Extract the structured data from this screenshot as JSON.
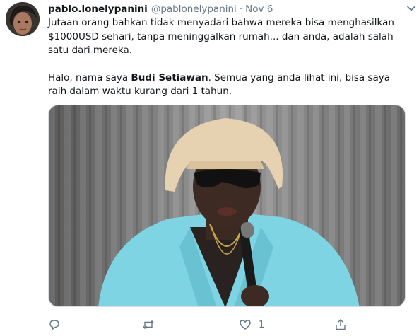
{
  "tweet": {
    "display_name": "pablo.lonelypanini",
    "handle": "@pablonelypanini",
    "separator": "·",
    "date": "Nov 6",
    "paragraph1": "Jutaan orang bahkan tidak menyadari bahwa mereka bisa menghasilkan $1000USD sehari, tanpa meninggalkan rumah... dan anda, adalah salah satu dari mereka.",
    "paragraph2_pre": "Halo, nama saya ",
    "paragraph2_bold": "Budi Setiawan",
    "paragraph2_post": ". Semua yang anda lihat ini, bisa saya raih dalam waktu kurang dari 1 tahun.",
    "like_count": "1"
  },
  "icons": {
    "reply": "reply-icon",
    "retweet": "retweet-icon",
    "like": "heart-icon",
    "share": "share-icon",
    "more": "chevron-down-icon"
  },
  "colors": {
    "text": "#14171a",
    "muted": "#657786",
    "jacket": "#7fd4e3",
    "wig": "#e6d2b0"
  }
}
